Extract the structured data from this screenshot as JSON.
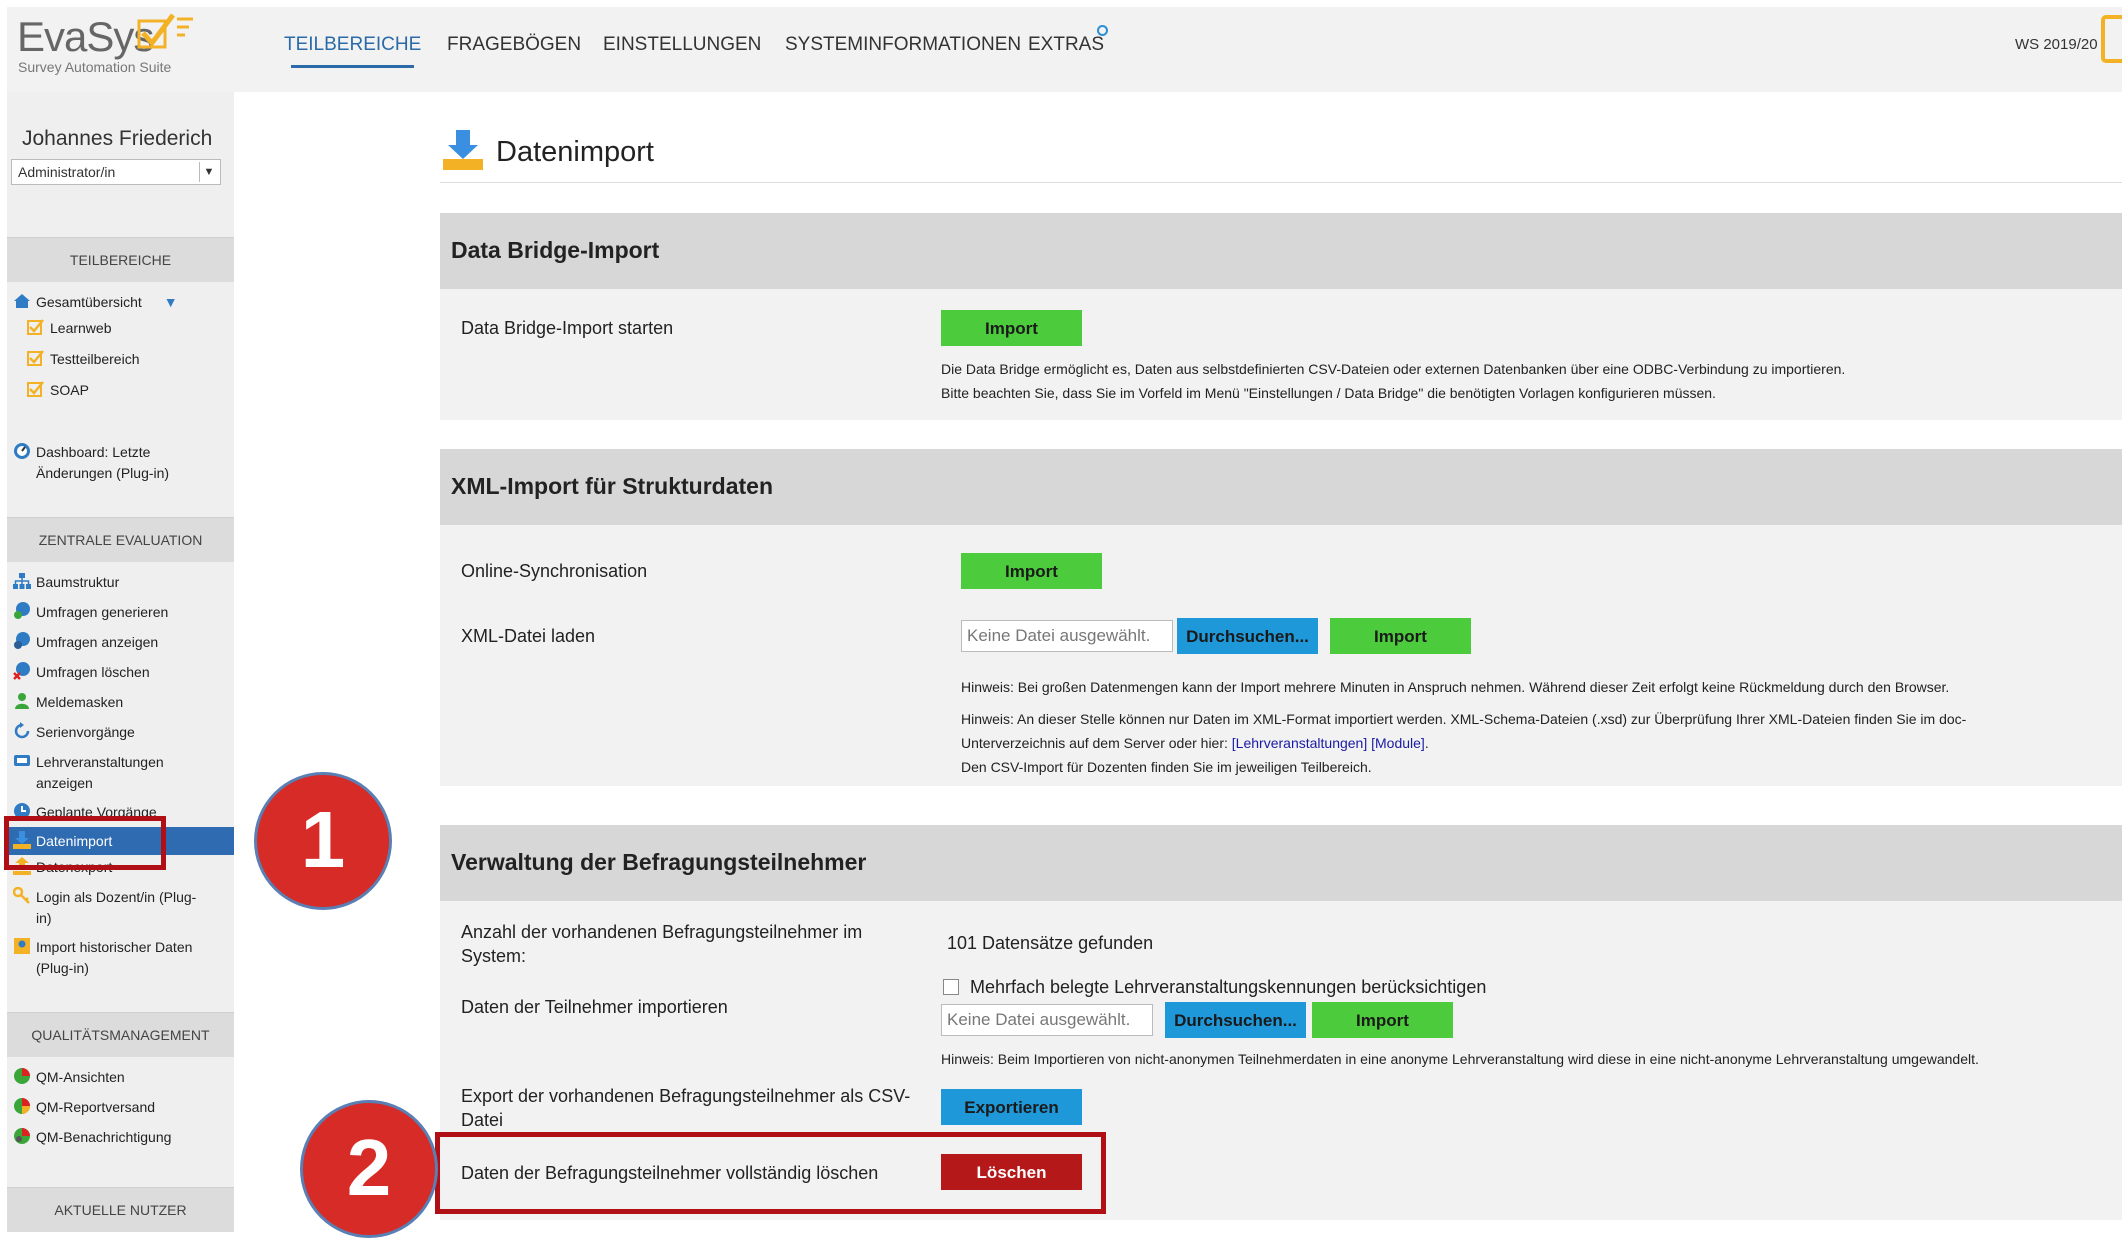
{
  "app": {
    "logo_text": "EvaSys",
    "logo_subtitle": "Survey Automation Suite",
    "semester": "WS 2019/20"
  },
  "nav": [
    {
      "label": "TEILBEREICHE"
    },
    {
      "label": "FRAGEBÖGEN"
    },
    {
      "label": "EINSTELLUNGEN"
    },
    {
      "label": "SYSTEMINFORMATIONEN"
    },
    {
      "label": "EXTRAS"
    }
  ],
  "sidebar": {
    "user_name": "Johannes Friederich",
    "role": "Administrator/in",
    "sections": {
      "teilbereiche": "TEILBEREICHE",
      "zentrale": "ZENTRALE EVALUATION",
      "qm": "QUALITÄTSMANAGEMENT",
      "nutzer": "AKTUELLE NUTZER"
    },
    "teilbereiche_items": [
      {
        "label": "Gesamtübersicht"
      },
      {
        "label": "Learnweb"
      },
      {
        "label": "Testteilbereich"
      },
      {
        "label": "SOAP"
      }
    ],
    "dashboard": {
      "line1": "Dashboard: Letzte",
      "line2": "Änderungen (Plug-in)"
    },
    "zentrale_items": [
      {
        "label": "Baumstruktur"
      },
      {
        "label": "Umfragen generieren"
      },
      {
        "label": "Umfragen anzeigen"
      },
      {
        "label": "Umfragen löschen"
      },
      {
        "label": "Meldemasken"
      },
      {
        "label": "Serienvorgänge"
      },
      {
        "label": "Lehrveranstaltungen",
        "label2": "anzeigen"
      },
      {
        "label": "Geplante Vorgänge"
      },
      {
        "label": "Datenimport"
      },
      {
        "label": "Datenexport"
      },
      {
        "label": "Login als Dozent/in (Plug-",
        "label2": "in)"
      },
      {
        "label": "Import historischer Daten",
        "label2": "(Plug-in)"
      }
    ],
    "qm_items": [
      {
        "label": "QM-Ansichten"
      },
      {
        "label": "QM-Reportversand"
      },
      {
        "label": "QM-Benachrichtigung"
      }
    ]
  },
  "page": {
    "title": "Datenimport"
  },
  "panels": {
    "bridge": {
      "title": "Data Bridge-Import",
      "row_label": "Data Bridge-Import starten",
      "button": "Import",
      "hint1": "Die Data Bridge ermöglicht es, Daten aus selbstdefinierten CSV-Dateien oder externen Datenbanken über eine ODBC-Verbindung zu importieren.",
      "hint2": "Bitte beachten Sie, dass Sie im Vorfeld im Menü \"Einstellungen / Data Bridge\" die benötigten Vorlagen konfigurieren müssen."
    },
    "xml": {
      "title": "XML-Import für Strukturdaten",
      "sync_label": "Online-Synchronisation",
      "sync_button": "Import",
      "file_label": "XML-Datei laden",
      "file_placeholder": "Keine Datei ausgewählt.",
      "browse_button": "Durchsuchen...",
      "import_button": "Import",
      "hint1": "Hinweis: Bei großen Datenmengen kann der Import mehrere Minuten in Anspruch nehmen. Während dieser Zeit erfolgt keine Rückmeldung durch den Browser.",
      "hint2": "Hinweis: An dieser Stelle können nur Daten im XML-Format importiert werden. XML-Schema-Dateien (.xsd) zur Überprüfung Ihrer XML-Dateien finden Sie im doc-",
      "hint3_pre": "Unterverzeichnis auf dem Server oder hier: ",
      "hint3_link": "[Lehrveranstaltungen] [Module]",
      "hint3_post": ".",
      "hint4": "Den CSV-Import für Dozenten finden Sie im jeweiligen Teilbereich."
    },
    "participants": {
      "title": "Verwaltung der Befragungsteilnehmer",
      "count_label_1": "Anzahl der vorhandenen Befragungsteilnehmer im",
      "count_label_2": "System:",
      "count_value": "101 Datensätze gefunden",
      "checkbox_label": "Mehrfach belegte Lehrveranstaltungskennungen berücksichtigen",
      "import_label": "Daten der Teilnehmer importieren",
      "file_placeholder": "Keine Datei ausgewählt.",
      "browse_button": "Durchsuchen...",
      "import_button": "Import",
      "hint": "Hinweis: Beim Importieren von nicht-anonymen Teilnehmerdaten in eine anonyme Lehrveranstaltung wird diese in eine nicht-anonyme Lehrveranstaltung umgewandelt.",
      "export_label_1": "Export der vorhandenen Befragungsteilnehmer als CSV-",
      "export_label_2": "Datei",
      "export_button": "Exportieren",
      "delete_label": "Daten der Befragungsteilnehmer vollständig löschen",
      "delete_button": "Löschen"
    }
  },
  "annotations": {
    "step1": "1",
    "step2": "2"
  },
  "colors": {
    "accent_blue": "#2b6aa8",
    "green_button": "#4ccb3c",
    "blue_button": "#1f98d9",
    "red_button": "#b51818",
    "callout_red": "#d62b26"
  }
}
